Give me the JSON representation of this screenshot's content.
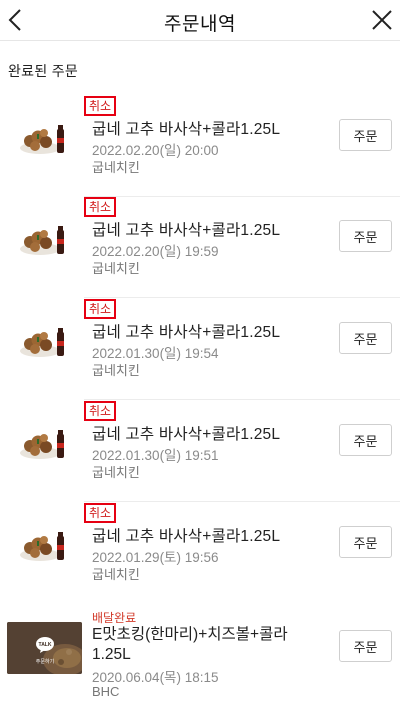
{
  "header": {
    "title": "주문내역",
    "back_icon": "chevron-left-icon",
    "close_icon": "close-icon"
  },
  "section_title": "완료된 주문",
  "orders": [
    {
      "status": "취소",
      "name": "굽네 고추 바사삭+콜라1.25L",
      "date": "2022.02.20(일) 20:00",
      "store": "굽네치킨",
      "button": "주문"
    },
    {
      "status": "취소",
      "name": "굽네 고추 바사삭+콜라1.25L",
      "date": "2022.02.20(일) 19:59",
      "store": "굽네치킨",
      "button": "주문"
    },
    {
      "status": "취소",
      "name": "굽네 고추 바사삭+콜라1.25L",
      "date": "2022.01.30(일) 19:54",
      "store": "굽네치킨",
      "button": "주문"
    },
    {
      "status": "취소",
      "name": "굽네 고추 바사삭+콜라1.25L",
      "date": "2022.01.30(일) 19:51",
      "store": "굽네치킨",
      "button": "주문"
    },
    {
      "status": "취소",
      "name": "굽네 고추 바사삭+콜라1.25L",
      "date": "2022.01.29(토) 19:56",
      "store": "굽네치킨",
      "button": "주문"
    }
  ],
  "last_order": {
    "status": "배달완료",
    "name": "E맛초킹(한마리)+치즈볼+콜라1.25L",
    "date": "2020.06.04(목) 18:15",
    "store": "BHC",
    "button": "주문",
    "badge_talk": "TALK",
    "badge_caption": "주문하기"
  },
  "colors": {
    "cancel_status": "#d11a1a",
    "cancel_highlight": "#e60012",
    "delivered_status": "#d23a2a"
  }
}
